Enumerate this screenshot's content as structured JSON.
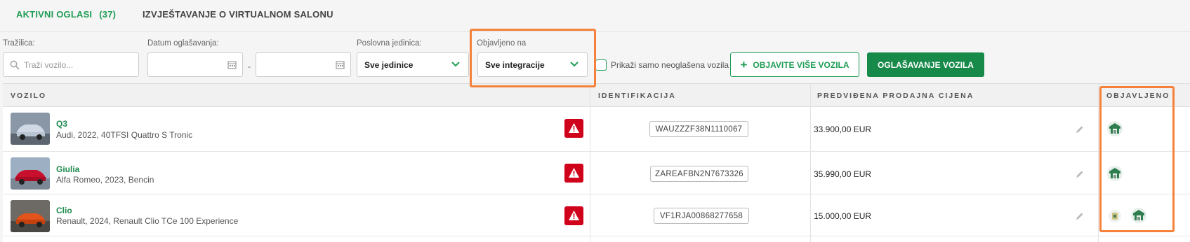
{
  "tabs": [
    {
      "label": "AKTIVNI OGLASI",
      "count": "(37)"
    },
    {
      "label": "IZVJEŠTAVANJE O VIRTUALNOM SALONU"
    }
  ],
  "filters": {
    "search": {
      "label": "Tražilica:",
      "placeholder": "Traži vozilo...",
      "value": ""
    },
    "date": {
      "label": "Datum oglašavanja:",
      "from": "",
      "to": "",
      "separator": "-"
    },
    "unit": {
      "label": "Poslovna jedinica:",
      "value": "Sve jedinice"
    },
    "published_on": {
      "label": "Objavljeno na",
      "value": "Sve integracije"
    },
    "only_unadvertised": {
      "label": "Prikaži samo neoglašena vozila",
      "checked": false
    }
  },
  "buttons": {
    "publish_more": "OBJAVITE VIŠE VOZILA",
    "advertise": "OGLAŠAVANJE VOZILA"
  },
  "table": {
    "headers": [
      "VOZILO",
      "IDENTIFIKACIJA",
      "PREDVIĐENA PRODAJNA CIJENA",
      "OBJAVLJENO"
    ],
    "rows": [
      {
        "model": "Q3",
        "details": "Audi, 2022, 40TFSI Quattro S Tronic",
        "vin": "WAUZZZF38N1110067",
        "price": "33.900,00 EUR",
        "published_icons": [
          "integration-logo-icon"
        ]
      },
      {
        "model": "Giulia",
        "details": "Alfa Romeo, 2023, Bencin",
        "vin": "ZAREAFBN2N7673326",
        "price": "35.990,00 EUR",
        "published_icons": [
          "integration-logo-icon"
        ]
      },
      {
        "model": "Clio",
        "details": "Renault, 2024, Renault Clio TCe 100 Experience",
        "vin": "VF1RJA00868277658",
        "price": "15.000,00 EUR",
        "published_icons": [
          "integration-logo-small-icon",
          "integration-logo-icon"
        ]
      }
    ]
  },
  "colors": {
    "accent": "#1f9d55",
    "primary_button": "#178a4a",
    "warning": "#d0021b",
    "highlight": "#f5813a"
  }
}
